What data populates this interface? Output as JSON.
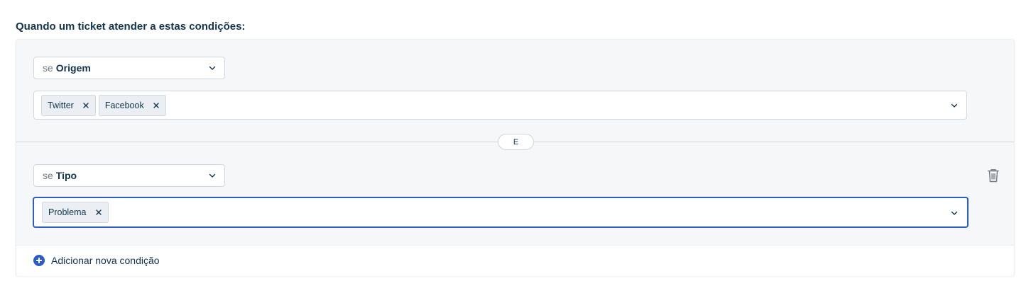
{
  "heading": "Quando um ticket atender a estas condições:",
  "conditions": [
    {
      "prefix": "se",
      "field": "Origem",
      "values": [
        "Twitter",
        "Facebook"
      ]
    },
    {
      "prefix": "se",
      "field": "Tipo",
      "values": [
        "Problema"
      ]
    }
  ],
  "operator_label": "E",
  "add_condition_label": "Adicionar nova condição",
  "icons": {
    "dropdown": "chevron-down-icon",
    "remove_tag": "close-icon",
    "delete": "trash-icon",
    "add": "plus-circle-icon"
  },
  "colors": {
    "accent": "#2c5cc5",
    "text": "#12344d",
    "panel_bg": "#f5f7f9"
  }
}
